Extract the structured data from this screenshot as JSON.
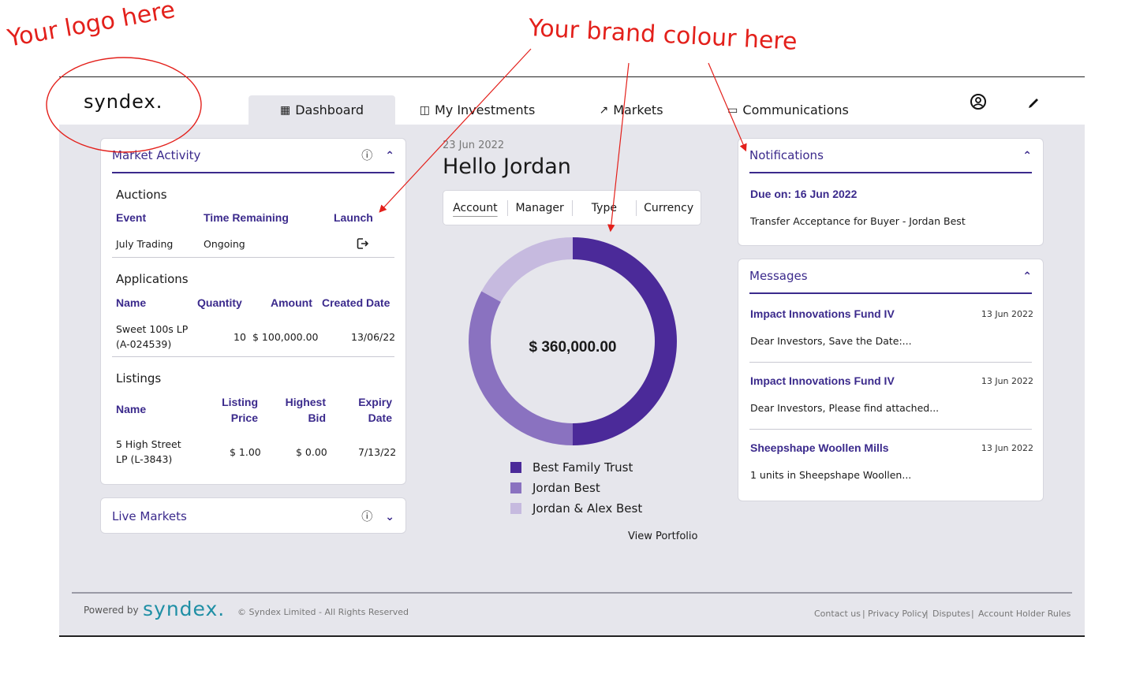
{
  "annotations": {
    "logo_note": "Your logo here",
    "brand_note": "Your brand colour here"
  },
  "header": {
    "logo": "syndex.",
    "tabs": [
      {
        "label": "Dashboard",
        "icon": "grid-icon",
        "active": true
      },
      {
        "label": "My Investments",
        "icon": "bar-chart-icon",
        "active": false
      },
      {
        "label": "Markets",
        "icon": "trend-up-icon",
        "active": false
      },
      {
        "label": "Communications",
        "icon": "message-icon",
        "active": false
      }
    ],
    "icons": [
      "user-circle-icon",
      "edit-pen-icon"
    ]
  },
  "market_activity": {
    "title": "Market Activity",
    "auctions": {
      "title": "Auctions",
      "headers": [
        "Event",
        "Time Remaining",
        "Launch"
      ],
      "rows": [
        {
          "event": "July Trading",
          "time_remaining": "Ongoing",
          "launch_icon": "launch-icon"
        }
      ]
    },
    "applications": {
      "title": "Applications",
      "headers": [
        "Name",
        "Quantity",
        "Amount",
        "Created Date"
      ],
      "rows": [
        {
          "name_1": "Sweet 100s LP",
          "name_2": "(A-024539)",
          "quantity": "10",
          "amount": "$ 100,000.00",
          "created": "13/06/22"
        }
      ]
    },
    "listings": {
      "title": "Listings",
      "headers": [
        "Name",
        "Listing",
        "Price",
        "Highest",
        "Bid",
        "Expiry",
        "Date"
      ],
      "rows": [
        {
          "name_1": "5 High Street",
          "name_2": "LP (L-3843)",
          "listing_price": "$ 1.00",
          "highest_bid": "$ 0.00",
          "expiry": "7/13/22"
        }
      ]
    }
  },
  "live_markets": {
    "title": "Live Markets"
  },
  "center": {
    "date": "23 Jun 2022",
    "greeting": "Hello Jordan",
    "filters": [
      "Account",
      "Manager",
      "Type",
      "Currency"
    ],
    "total": "$ 360,000.00",
    "view_portfolio": "View Portfolio"
  },
  "chart_data": {
    "type": "pie",
    "donut": true,
    "title": "",
    "series": [
      {
        "name": "Best Family Trust",
        "value": 0.5,
        "color": "#4b2a99"
      },
      {
        "name": "Jordan Best",
        "value": 0.33,
        "color": "#8a72c0"
      },
      {
        "name": "Jordan & Alex Best",
        "value": 0.17,
        "color": "#c6badf"
      }
    ],
    "legend": "bottom"
  },
  "notifications": {
    "title": "Notifications",
    "due": "Due on: 16 Jun 2022",
    "text": "Transfer Acceptance for Buyer - Jordan Best"
  },
  "messages": {
    "title": "Messages",
    "items": [
      {
        "title": "Impact Innovations Fund IV",
        "date": "13 Jun 2022",
        "body": "Dear Investors, Save the Date:..."
      },
      {
        "title": "Impact Innovations Fund IV",
        "date": "13 Jun 2022",
        "body": "Dear Investors, Please find attached..."
      },
      {
        "title": "Sheepshape Woollen Mills",
        "date": "13 Jun 2022",
        "body": "1 units in Sheepshape Woollen..."
      }
    ]
  },
  "footer": {
    "powered_by": "Powered by",
    "brand": "syndex.",
    "copyright": "© Syndex Limited - All Rights Reserved",
    "links": [
      "Contact us",
      "Privacy Policy",
      "Disputes",
      "Account Holder Rules"
    ]
  },
  "colors": {
    "brand": "#3b2a8c",
    "accent_teal": "#1f8fa5",
    "annotation": "#e3201b",
    "background": "#e6e6ec"
  }
}
